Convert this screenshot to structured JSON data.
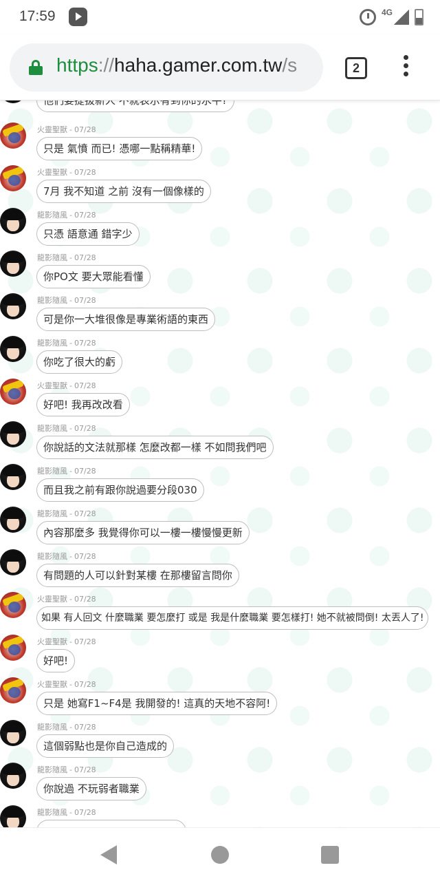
{
  "status_bar": {
    "time": "17:59",
    "app_icon": "play-store-icon",
    "network": "4G",
    "icons": [
      "alarm-icon",
      "signal-icon",
      "battery-icon"
    ]
  },
  "browser": {
    "url_scheme": "https",
    "url_separator": "://",
    "url_host": "haha.gamer.com.tw",
    "url_path": "/s",
    "tab_count": "2",
    "icons": [
      "lock-icon",
      "tabs-icon",
      "more-vert-icon"
    ]
  },
  "colors": {
    "secure_green": "#1e8e3e",
    "bubble_border": "#bdbdbd",
    "meta_gray": "#9a9a9a"
  },
  "chat": {
    "messages": [
      {
        "avatar": "dragon",
        "author": "",
        "date": "",
        "text": "他們要提拔新人 不就表示有到你的水平?"
      },
      {
        "avatar": "fire",
        "author": "火靈聖獸",
        "date": "07/28",
        "text": "只是 氣憤 而已! 憑哪一點稱精華!"
      },
      {
        "avatar": "fire",
        "author": "火靈聖獸",
        "date": "07/28",
        "text": "7月 我不知道 之前 沒有一個像樣的"
      },
      {
        "avatar": "dragon",
        "author": "龍影隨風",
        "date": "07/28",
        "text": "只憑 語意通 錯字少"
      },
      {
        "avatar": "dragon",
        "author": "龍影隨風",
        "date": "07/28",
        "text": "你PO文 要大眾能看懂"
      },
      {
        "avatar": "dragon",
        "author": "龍影隨風",
        "date": "07/28",
        "text": "可是你一大堆很像是專業術語的東西"
      },
      {
        "avatar": "dragon",
        "author": "龍影隨風",
        "date": "07/28",
        "text": "你吃了很大的虧"
      },
      {
        "avatar": "fire",
        "author": "火靈聖獸",
        "date": "07/28",
        "text": "好吧! 我再改改看"
      },
      {
        "avatar": "dragon",
        "author": "龍影隨風",
        "date": "07/28",
        "text": "你說話的文法就那樣 怎麼改都一樣 不如問我們吧"
      },
      {
        "avatar": "dragon",
        "author": "龍影隨風",
        "date": "07/28",
        "text": "而且我之前有跟你說過要分段030"
      },
      {
        "avatar": "dragon",
        "author": "龍影隨風",
        "date": "07/28",
        "text": "內容那麼多 我覺得你可以一樓一樓慢慢更新"
      },
      {
        "avatar": "dragon",
        "author": "龍影隨風",
        "date": "07/28",
        "text": "有問題的人可以針對某樓 在那樓留言問你"
      },
      {
        "avatar": "fire",
        "author": "火靈聖獸",
        "date": "07/28",
        "text": "如果 有人回文 什麼職業 要怎麼打 或是 我是什麼職業 要怎樣打! 她不就被問倒! 太丟人了!"
      },
      {
        "avatar": "fire",
        "author": "火靈聖獸",
        "date": "07/28",
        "text": "好吧!"
      },
      {
        "avatar": "fire",
        "author": "火靈聖獸",
        "date": "07/28",
        "text": "只是 她寫F1~F4是 我開發的! 這真的天地不容阿!"
      },
      {
        "avatar": "dragon",
        "author": "龍影隨風",
        "date": "07/28",
        "text": "這個弱點也是你自己造成的"
      },
      {
        "avatar": "dragon",
        "author": "龍影隨風",
        "date": "07/28",
        "text": "你說過 不玩弱者職業"
      },
      {
        "avatar": "dragon",
        "author": "龍影隨風",
        "date": "07/28",
        "text": ""
      }
    ]
  },
  "nav_bar": {
    "icons": [
      "back-icon",
      "home-icon",
      "recents-icon"
    ]
  }
}
